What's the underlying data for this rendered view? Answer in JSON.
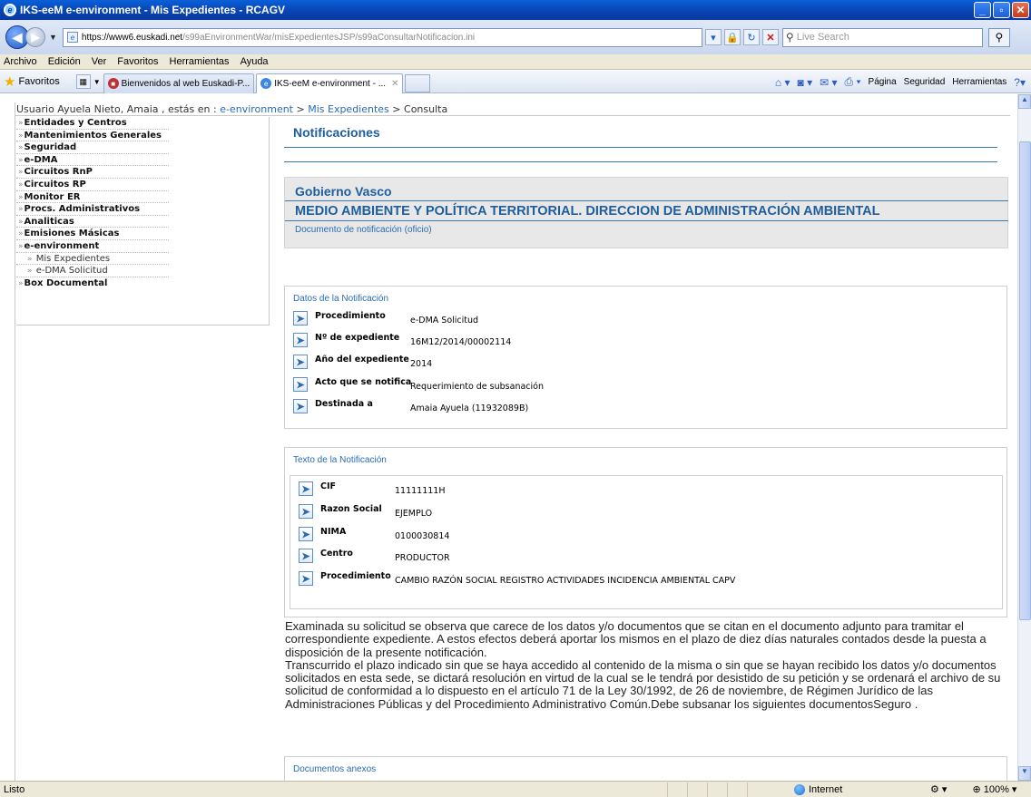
{
  "window": {
    "title": "IKS-eeM e-environment - Mis Expedientes - RCAGV"
  },
  "address": {
    "url_domain": "https://www6.euskadi.net",
    "url_path": "/s99aEnvironmentWar/misExpedientesJSP/s99aConsultarNotificacion.ini",
    "search_placeholder": "Live Search"
  },
  "menu": {
    "items": [
      "Archivo",
      "Edición",
      "Ver",
      "Favoritos",
      "Herramientas",
      "Ayuda"
    ]
  },
  "favbar": {
    "favorites_label": "Favoritos",
    "tabs": [
      {
        "label": "Bienvenidos al web Euskadi-P..."
      },
      {
        "label": "IKS-eeM e-environment - ..."
      }
    ],
    "commands": [
      "Página",
      "Seguridad",
      "Herramientas"
    ]
  },
  "breadcrumb": {
    "prefix": "Usuario Ayuela Nieto, Amaia , estás en : ",
    "link1": "e-environment",
    "sep1": " > ",
    "link2": "Mis Expedientes",
    "sep2": " > ",
    "current": "Consulta"
  },
  "left_menu": {
    "items": [
      {
        "label": "Entidades y Centros"
      },
      {
        "label": "Mantenimientos Generales"
      },
      {
        "label": "Seguridad"
      },
      {
        "label": "e-DMA"
      },
      {
        "label": "Circuitos RnP"
      },
      {
        "label": "Circuitos RP"
      },
      {
        "label": "Monitor ER"
      },
      {
        "label": "Procs. Administrativos"
      },
      {
        "label": "Analiticas"
      },
      {
        "label": "Emisiones Másicas"
      },
      {
        "label": "e-environment"
      },
      {
        "label": "Mis Expedientes"
      },
      {
        "label": "e-DMA Solicitud"
      },
      {
        "label": "Box Documental"
      }
    ]
  },
  "main": {
    "title": "Notificaciones",
    "org": "Gobierno Vasco",
    "department": "MEDIO AMBIENTE Y POLÍTICA TERRITORIAL. DIRECCION DE ADMINISTRACIÓN AMBIENTAL",
    "doc_type": "Documento de notificación (oficio)"
  },
  "datos": {
    "title": "Datos de la Notificación",
    "fields": [
      {
        "label": "Procedimiento",
        "value": "e-DMA Solicitud"
      },
      {
        "label": "Nº de expediente",
        "value": "16M12/2014/00002114"
      },
      {
        "label": "Año del expediente",
        "value": "2014"
      },
      {
        "label": "Acto que se notifica",
        "value": "Requerimiento de subsanación"
      },
      {
        "label": "Destinada a",
        "value": "Amaia Ayuela (11932089B)"
      }
    ]
  },
  "texto": {
    "title": "Texto de la Notificación",
    "fields": [
      {
        "label": "CIF",
        "value": "11111111H"
      },
      {
        "label": "Razon Social",
        "value": "EJEMPLO"
      },
      {
        "label": "NIMA",
        "value": "0100030814"
      },
      {
        "label": "Centro",
        "value": "PRODUCTOR"
      },
      {
        "label": "Procedimiento",
        "value": "CAMBIO RAZÓN SOCIAL REGISTRO ACTIVIDADES INCIDENCIA AMBIENTAL CAPV"
      }
    ]
  },
  "body": {
    "paragraph1": "Examinada su solicitud se observa que carece de los datos y/o documentos que se citan en el documento adjunto para tramitar el correspondiente expediente. A estos efectos deberá aportar los mismos en el plazo de diez días naturales contados desde la puesta a disposición de la presente notificación.",
    "paragraph2": "Transcurrido el plazo indicado sin que se haya accedido al contenido de la misma o sin que se hayan recibido los datos y/o documentos solicitados en esta sede, se dictará resolución en virtud de la cual se le tendrá por desistido de su petición y se ordenará el archivo de su solicitud de conformidad a lo dispuesto en el artículo 71 de la Ley 30/1992, de 26 de noviembre, de Régimen Jurídico de las Administraciones Públicas y del Procedimiento Administrativo Común.Debe subsanar los siguientes documentosSeguro ."
  },
  "anexos": {
    "title": "Documentos anexos"
  },
  "status": {
    "text": "Listo",
    "zone": "Internet",
    "zoom": "100%"
  }
}
